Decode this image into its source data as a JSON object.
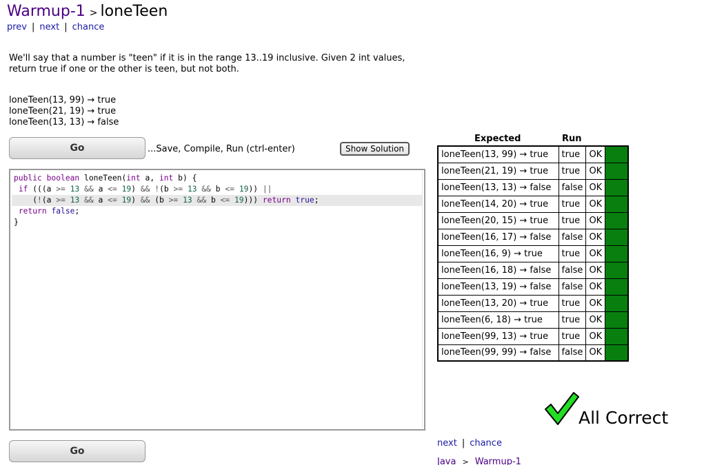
{
  "header": {
    "section_link": "Warmup-1",
    "separator": ">",
    "problem_name": "loneTeen"
  },
  "nav": {
    "prev": "prev",
    "pipe": "|",
    "next": "next",
    "chance": "chance"
  },
  "description": "We'll say that a number is \"teen\" if it is in the range 13..19 inclusive. Given 2 int values, return true if one or the other is teen, but not both.",
  "examples": [
    "loneTeen(13, 99) → true",
    "loneTeen(21, 19) → true",
    "loneTeen(13, 13) → false"
  ],
  "toolbar": {
    "go_label": "Go",
    "save_hint": "...Save, Compile, Run (ctrl-enter)",
    "show_solution_label": "Show Solution"
  },
  "editor": {
    "lines": [
      "public boolean loneTeen(int a, int b) {",
      " if (((a >= 13 && a <= 19) && !(b >= 13 && b <= 19)) ||",
      "    (!(a >= 13 && a <= 19) && (b >= 13 && b <= 19))) return true;",
      " return false;",
      "}"
    ],
    "active_line": 2
  },
  "results": {
    "header_expected": "Expected",
    "header_run": "Run",
    "rows": [
      {
        "expected": "loneTeen(13, 99) → true",
        "run": "true",
        "status": "OK"
      },
      {
        "expected": "loneTeen(21, 19) → true",
        "run": "true",
        "status": "OK"
      },
      {
        "expected": "loneTeen(13, 13) → false",
        "run": "false",
        "status": "OK"
      },
      {
        "expected": "loneTeen(14, 20) → true",
        "run": "true",
        "status": "OK"
      },
      {
        "expected": "loneTeen(20, 15) → true",
        "run": "true",
        "status": "OK"
      },
      {
        "expected": "loneTeen(16, 17) → false",
        "run": "false",
        "status": "OK"
      },
      {
        "expected": "loneTeen(16, 9) → true",
        "run": "true",
        "status": "OK"
      },
      {
        "expected": "loneTeen(16, 18) → false",
        "run": "false",
        "status": "OK"
      },
      {
        "expected": "loneTeen(13, 19) → false",
        "run": "false",
        "status": "OK"
      },
      {
        "expected": "loneTeen(13, 20) → true",
        "run": "true",
        "status": "OK"
      },
      {
        "expected": "loneTeen(6, 18) → true",
        "run": "true",
        "status": "OK"
      },
      {
        "expected": "loneTeen(99, 13) → true",
        "run": "true",
        "status": "OK"
      },
      {
        "expected": "loneTeen(99, 99) → false",
        "run": "false",
        "status": "OK"
      }
    ],
    "pass_color": "#087f0f"
  },
  "summary": {
    "icon": "checkmark-icon",
    "text": "All Correct",
    "icon_color": "#22dd22"
  },
  "bottom_nav": {
    "next": "next",
    "pipe": "|",
    "chance": "chance"
  },
  "bottom_breadcrumb": {
    "root": "Java",
    "separator": ">",
    "section": "Warmup-1"
  }
}
